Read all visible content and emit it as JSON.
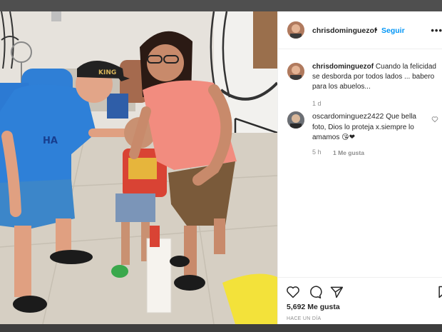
{
  "post": {
    "username": "chrisdominguezof",
    "follow_label": "Seguir",
    "separator": "•",
    "more_label": "•••",
    "caption_text": "Cuando la felicidad se desborda por todos lados ... babero para los abuelos...",
    "caption_time": "1 d",
    "likes_label": "5,692 Me gusta",
    "posted_ago": "HACE UN DÍA"
  },
  "comment": {
    "username": "oscardominguez2422",
    "text": "Que bella foto, Dios lo proteja x.siempre lo amamos",
    "emojis": "😘❤",
    "time": "5 h",
    "likes": "1 Me gusta"
  },
  "photo": {
    "cap_text": "KING",
    "shirt_text": "HA"
  },
  "icons": {
    "like": "heart-outline-icon",
    "comment": "speech-bubble-icon",
    "share": "paper-plane-icon",
    "save": "bookmark-icon",
    "comment_like": "small-heart-icon",
    "more": "more-options-icon"
  },
  "colors": {
    "follow_blue": "#0095f6",
    "text_dark": "#262626",
    "text_muted": "#8e8e8e"
  }
}
